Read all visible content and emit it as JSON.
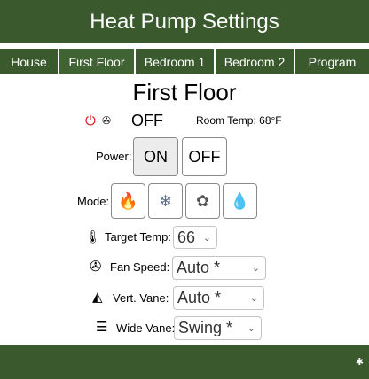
{
  "app": {
    "title": "Heat Pump Settings"
  },
  "tabs": [
    "House",
    "First Floor",
    "Bedroom 1",
    "Bedroom 2",
    "Program"
  ],
  "active_tab": "First Floor",
  "main": {
    "title": "First Floor"
  },
  "status": {
    "state": "OFF",
    "room_temp_label": "Room Temp: 68°F"
  },
  "power": {
    "label": "Power:",
    "on_label": "ON",
    "off_label": "OFF",
    "selected": "ON"
  },
  "mode": {
    "label": "Mode:",
    "options": [
      "heat",
      "cool",
      "fan",
      "dry"
    ]
  },
  "target_temp": {
    "label": "Target Temp:",
    "value": "66"
  },
  "fan_speed": {
    "label": "Fan Speed:",
    "value": "Auto *"
  },
  "vert_vane": {
    "label": "Vert. Vane:",
    "value": "Auto *"
  },
  "wide_vane": {
    "label": "Wide Vane:",
    "value": "Swing *"
  },
  "colors": {
    "header_bg": "#3a5a2e",
    "power_icon": "#dd1111"
  },
  "icons": [
    "power-icon",
    "fan-icon",
    "flame-icon",
    "snowflake-icon",
    "gear-icon",
    "droplet-icon",
    "thermometer-icon",
    "vane-icon",
    "wide-vane-icon"
  ]
}
